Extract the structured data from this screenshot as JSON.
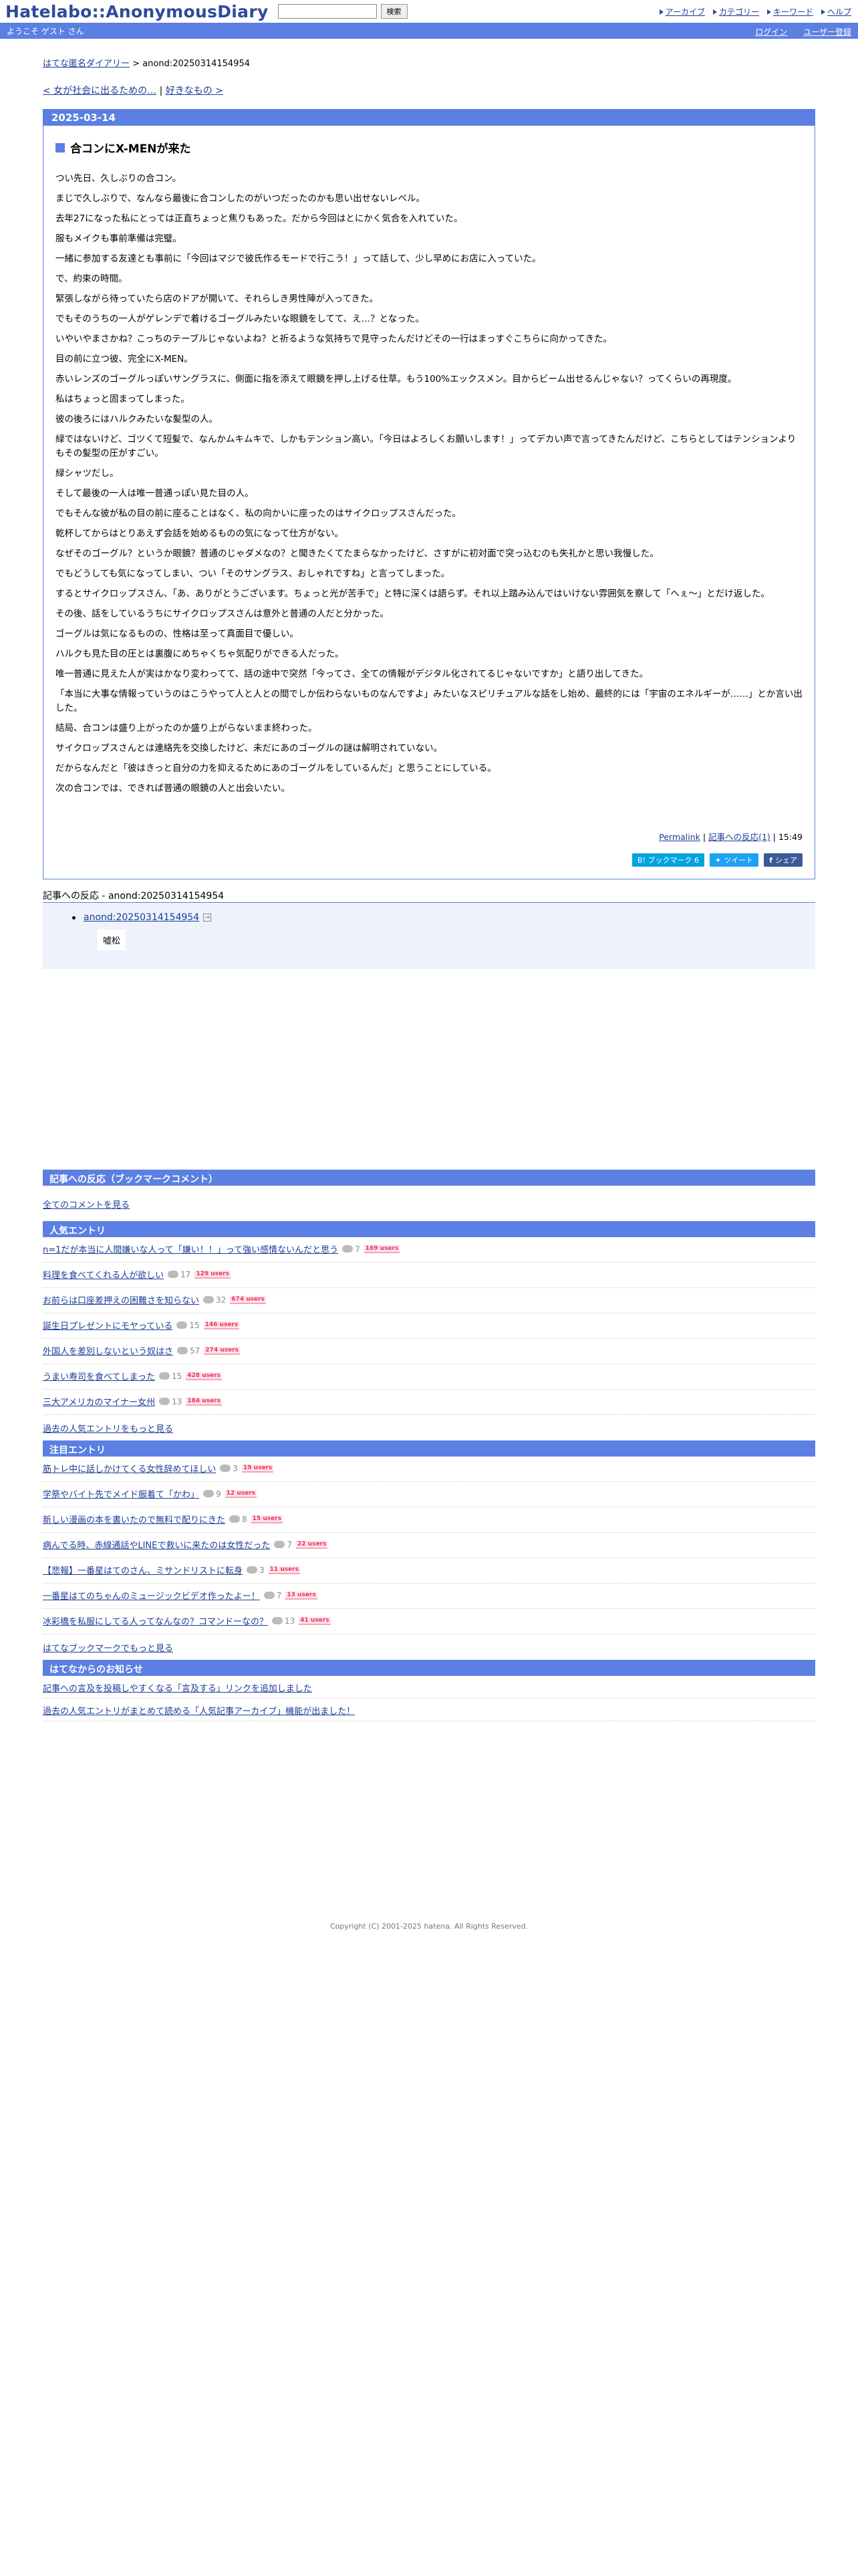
{
  "header": {
    "logo": "Hatelabo::AnonymousDiary",
    "search_placeholder": "",
    "search_button": "検索",
    "nav": [
      "アーカイブ",
      "カテゴリー",
      "キーワード",
      "ヘルプ"
    ]
  },
  "welcome": {
    "text": "ようこそ ゲスト さん",
    "login": "ログイン",
    "register": "ユーザー登録"
  },
  "breadcrumb": {
    "home": "はてな匿名ダイアリー",
    "sep": " > ",
    "current": "anond:20250314154954"
  },
  "pager": {
    "prev": "< 女が社会に出るための…",
    "sep": " | ",
    "next": "好きなもの >"
  },
  "article": {
    "date": "2025-03-14",
    "title": "合コンにX-MENが来た",
    "paragraphs": [
      "つい先日、久しぶりの合コン。",
      "まじで久しぶりで、なんなら最後に合コンしたのがいつだったのかも思い出せないレベル。",
      "去年27になった私にとっては正直ちょっと焦りもあった。だから今回はとにかく気合を入れていた。",
      "服もメイクも事前準備は完璧。",
      "一緒に参加する友達とも事前に「今回はマジで彼氏作るモードで行こう！」って話して、少し早めにお店に入っていた。",
      "で、約束の時間。",
      "緊張しながら待っていたら店のドアが開いて、それらしき男性陣が入ってきた。",
      "でもそのうちの一人がゲレンデで着けるゴーグルみたいな眼鏡をしてて、え…？となった。",
      "いやいやまさかね？こっちのテーブルじゃないよね？と祈るような気持ちで見守ったんだけどその一行はまっすぐこちらに向かってきた。",
      "目の前に立つ彼、完全にX-MEN。",
      "赤いレンズのゴーグルっぽいサングラスに、側面に指を添えて眼鏡を押し上げる仕草。もう100%エックスメン。目からビーム出せるんじゃない？ってくらいの再現度。",
      "私はちょっと固まってしまった。",
      "彼の後ろにはハルクみたいな髪型の人。",
      "緑ではないけど、ゴツくて短髪で、なんかムキムキで、しかもテンション高い。「今日はよろしくお願いします！」ってデカい声で言ってきたんだけど、こちらとしてはテンションよりもその髪型の圧がすごい。",
      "緑シャツだし。",
      "そして最後の一人は唯一普通っぽい見た目の人。",
      "でもそんな彼が私の目の前に座ることはなく、私の向かいに座ったのはサイクロップスさんだった。",
      "乾杯してからはとりあえず会話を始めるものの気になって仕方がない。",
      "なぜそのゴーグル？というか眼鏡？普通のじゃダメなの？と聞きたくてたまらなかったけど、さすがに初対面で突っ込むのも失礼かと思い我慢した。",
      "でもどうしても気になってしまい、つい「そのサングラス、おしゃれですね」と言ってしまった。",
      "するとサイクロップスさん、「あ、ありがとうございます。ちょっと光が苦手で」と特に深くは語らず。それ以上踏み込んではいけない雰囲気を察して「へぇ〜」とだけ返した。",
      "その後、話をしているうちにサイクロップスさんは意外と普通の人だと分かった。",
      "ゴーグルは気になるものの、性格は至って真面目で優しい。",
      "ハルクも見た目の圧とは裏腹にめちゃくちゃ気配りができる人だった。",
      "唯一普通に見えた人が実はかなり変わってて、話の途中で突然「今ってさ、全ての情報がデジタル化されてるじゃないですか」と語り出してきた。",
      "「本当に大事な情報っていうのはこうやって人と人との間でしか伝わらないものなんですよ」みたいなスピリチュアルな話をし始め、最終的には「宇宙のエネルギーが……」とか言い出した。",
      "結局、合コンは盛り上がったのか盛り上がらないまま終わった。",
      "サイクロップスさんとは連絡先を交換したけど、未だにあのゴーグルの謎は解明されていない。",
      "だからなんだと「彼はきっと自分の力を抑えるためにあのゴーグルをしているんだ」と思うことにしている。",
      "次の合コンでは、できれば普通の眼鏡の人と出会いたい。"
    ],
    "footer": {
      "permalink": "Permalink",
      "sep": " | ",
      "reactions": "記事への反応(1)",
      "sep2": " | ",
      "time": "15:49"
    },
    "share": {
      "hatena": "B! ブックマーク  6",
      "twitter": "ツイート",
      "facebook": "シェア"
    }
  },
  "reactions": {
    "head": "記事への反応 - anond:20250314154954",
    "items": [
      {
        "link": "anond:20250314154954",
        "text": "嘘松"
      }
    ]
  },
  "bookmark_comments": {
    "head": "記事への反応（ブックマークコメント）",
    "all_link": "全てのコメントを見る"
  },
  "popular": {
    "head": "人気エントリ",
    "entries": [
      {
        "title": "n=1だが本当に人間嫌いな人って「嫌い！！」って強い感情ないんだと思う",
        "count": "7",
        "users": "169 users"
      },
      {
        "title": "料理を食べてくれる人が欲しい",
        "count": "17",
        "users": "129 users"
      },
      {
        "title": "お前らは口座差押えの困難さを知らない",
        "count": "32",
        "users": "674 users"
      },
      {
        "title": "誕生日プレゼントにモヤっている",
        "count": "15",
        "users": "146 users"
      },
      {
        "title": "外国人を差別しないという奴はさ",
        "count": "57",
        "users": "274 users"
      },
      {
        "title": "うまい寿司を食べてしまった",
        "count": "15",
        "users": "428 users"
      },
      {
        "title": "三大アメリカのマイナー女州",
        "count": "13",
        "users": "184 users"
      }
    ],
    "more": "過去の人気エントリをもっと見る"
  },
  "featured": {
    "head": "注目エントリ",
    "entries": [
      {
        "title": "筋トレ中に話しかけてくる女性辞めてほしい",
        "count": "3",
        "users": "19 users"
      },
      {
        "title": "学祭やバイト先でメイド服着て「かわ」",
        "count": "9",
        "users": "12 users"
      },
      {
        "title": "新しい漫画の本を書いたので無料で配りにきた",
        "count": "8",
        "users": "15 users"
      },
      {
        "title": "病んでる時、赤線通話やLINEで救いに来たのは女性だった",
        "count": "7",
        "users": "22 users"
      },
      {
        "title": "【悲報】一番星はてのさん、ミサンドリストに転身",
        "count": "3",
        "users": "11 users"
      },
      {
        "title": "一番星はてのちゃんのミュージックビデオ作ったよー！",
        "count": "7",
        "users": "13 users"
      },
      {
        "title": "冰彩橋を私服にしてる人ってなんなの？コマンドーなの？",
        "count": "13",
        "users": "41 users"
      }
    ],
    "more": "はてなブックマークでもっと見る"
  },
  "notices": {
    "head": "はてなからのお知らせ",
    "items": [
      "記事への言及を投稿しやすくなる「言及する」リンクを追加しました",
      "過去の人気エントリがまとめて読める「人気記事アーカイブ」機能が出ました！"
    ]
  },
  "copyright": "Copyright (C) 2001-2025 hatena. All Rights Reserved."
}
